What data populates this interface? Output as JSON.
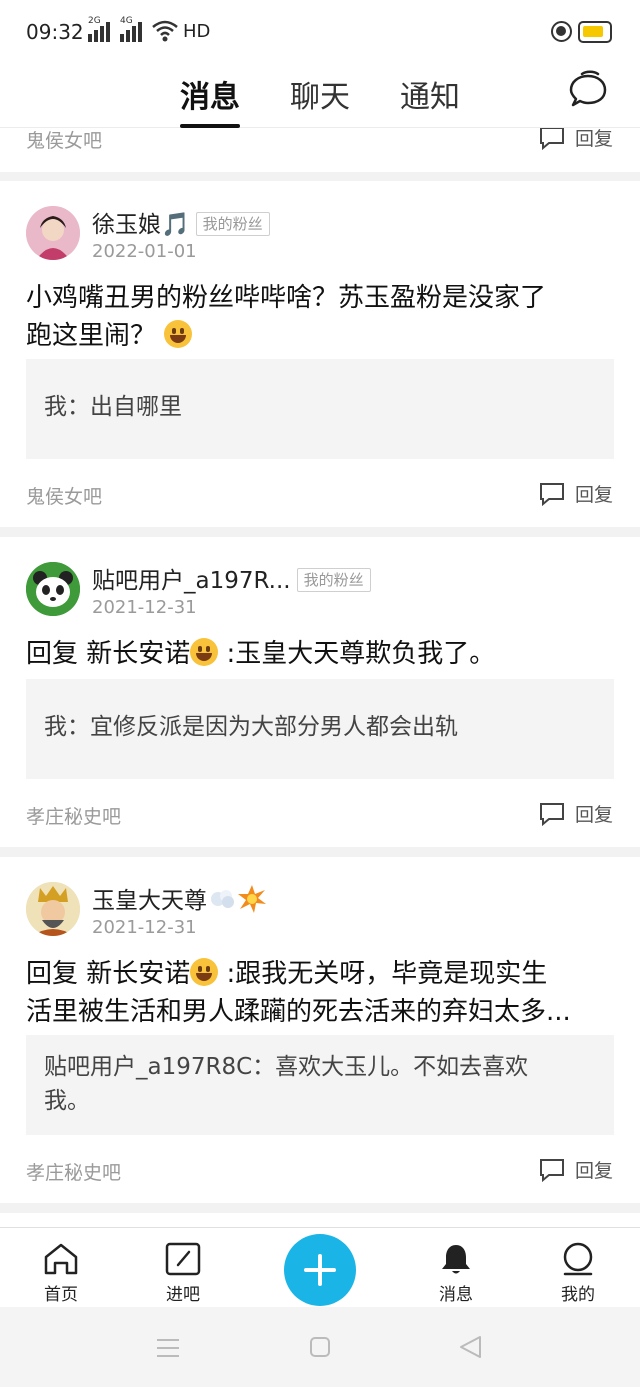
{
  "status_bar": {
    "time": "09:32",
    "sim1": "2G",
    "sim2": "4G",
    "hd": "HD"
  },
  "header": {
    "tabs": [
      "消息",
      "聊天",
      "通知"
    ],
    "active_tab": "消息"
  },
  "feed": {
    "top_partial": {
      "forum": "鬼侯女吧",
      "reply_label": "回复"
    },
    "items": [
      {
        "username": "徐玉娘🎵",
        "badge": "我的粉丝",
        "date": "2022-01-01",
        "content_line1": "小鸡嘴丑男的粉丝哔哔啥？苏玉盈粉是没家了",
        "content_line2": "跑这里闹？",
        "quote": "我：出自哪里",
        "forum": "鬼侯女吧",
        "reply_label": "回复"
      },
      {
        "username": "贴吧用户_a197R...",
        "badge": "我的粉丝",
        "date": "2021-12-31",
        "content_prefix": "回复  新长安诺",
        "content_suffix": " :玉皇大天尊欺负我了。",
        "quote": "我：宜修反派是因为大部分男人都会出轨",
        "forum": "孝庄秘史吧",
        "reply_label": "回复"
      },
      {
        "username": "玉皇大天尊",
        "date": "2021-12-31",
        "content_prefix": "回复  新长安诺",
        "content_suffix": " :跟我无关呀，毕竟是现实生",
        "content_line2": "活里被生活和男人蹂躏的死去活来的弃妇太多...",
        "quote_line1": "贴吧用户_a197R8C：喜欢大玉儿。不如去喜欢",
        "quote_line2": "我。",
        "forum": "孝庄秘史吧",
        "reply_label": "回复"
      }
    ]
  },
  "bottom_nav": {
    "items": [
      {
        "label": "首页",
        "icon": "home-icon"
      },
      {
        "label": "进吧",
        "icon": "enter-forum-icon"
      },
      {
        "label": "消息",
        "icon": "bell-icon"
      },
      {
        "label": "我的",
        "icon": "profile-icon"
      }
    ],
    "post_icon": "plus-icon"
  },
  "colors": {
    "accent": "#1ab4e6",
    "battery": "#f5c800",
    "feed_bg": "#f2f2f2",
    "quote_bg": "#f4f4f4"
  }
}
